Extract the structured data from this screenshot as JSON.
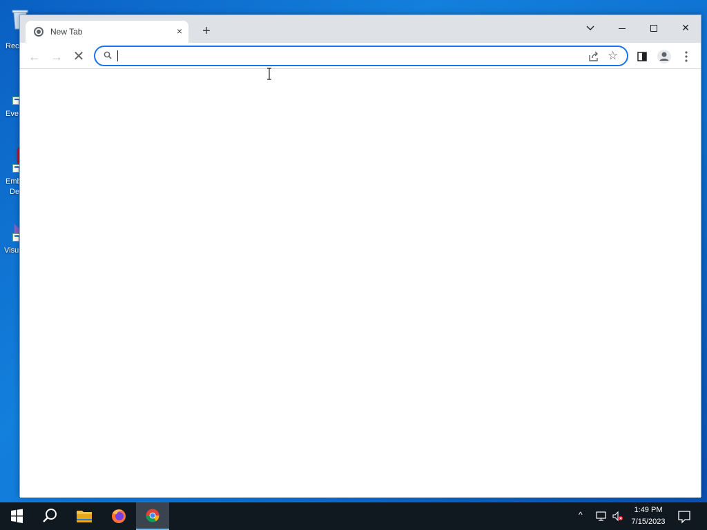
{
  "desktop": {
    "icons": [
      {
        "label": "Rec"
      },
      {
        "label": "Eve"
      },
      {
        "label": "Emb"
      },
      {
        "label": "De"
      },
      {
        "label": "Visu"
      }
    ]
  },
  "browser": {
    "tab": {
      "title": "New Tab",
      "close": "×"
    },
    "new_tab": "+",
    "window_controls": {
      "chevron": "⌄",
      "close": "✕"
    },
    "nav": {
      "back": "←",
      "forward": "→",
      "stop": "✕"
    },
    "omnibox": {
      "value": "",
      "placeholder": ""
    },
    "star": "☆"
  },
  "taskbar": {
    "clock_time": "1:49 PM",
    "clock_date": "7/15/2023",
    "tray_chevron": "^"
  },
  "colors": {
    "accent": "#1a73e8",
    "titlebar": "#dee1e6",
    "taskbar": "#101820",
    "desktop": "#0f6fd0"
  }
}
